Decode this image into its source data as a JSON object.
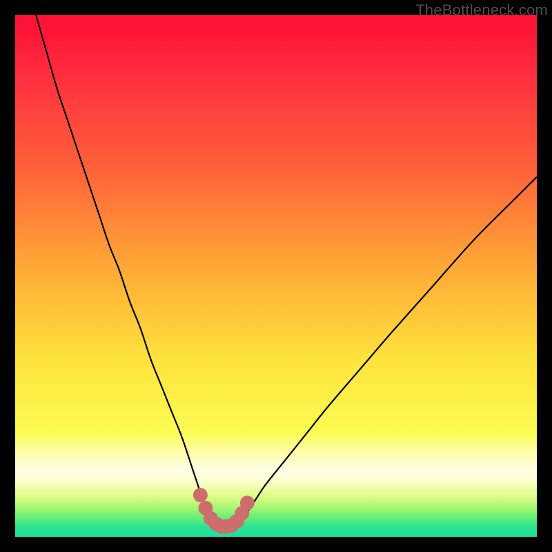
{
  "watermark": "TheBottleneck.com",
  "colors": {
    "frame": "#000000",
    "curve": "#000000",
    "marker_fill": "#cf6d6c",
    "marker_stroke": "#cf6d6c"
  },
  "chart_data": {
    "type": "line",
    "title": "",
    "xlabel": "",
    "ylabel": "",
    "xlim": [
      0,
      100
    ],
    "ylim": [
      0,
      100
    ],
    "grid": false,
    "legend": false,
    "series": [
      {
        "name": "bottleneck-curve",
        "x": [
          4,
          6,
          8,
          10,
          12,
          14,
          16,
          18,
          20,
          22,
          24,
          26,
          28,
          30,
          32,
          34,
          35,
          36,
          37,
          38,
          39,
          40,
          41,
          42,
          43,
          44,
          46,
          48,
          52,
          56,
          60,
          66,
          72,
          80,
          88,
          96,
          100
        ],
        "values": [
          100,
          93,
          86,
          80,
          74,
          68,
          62,
          56,
          51,
          45,
          40,
          34,
          29,
          24,
          19,
          13,
          10,
          7,
          4.5,
          3,
          2.2,
          2,
          2,
          2.2,
          2.8,
          4,
          7,
          10,
          15,
          20,
          25,
          32,
          39,
          48,
          57,
          65,
          69
        ]
      }
    ],
    "markers": {
      "name": "highlight-dots",
      "x": [
        35.5,
        36.5,
        37.5,
        38.5,
        39.5,
        40.5,
        41.5,
        42.5,
        43.5,
        44.5
      ],
      "values": [
        8,
        5.5,
        3.5,
        2.5,
        2,
        2,
        2.2,
        3,
        4.5,
        6.5
      ]
    }
  }
}
